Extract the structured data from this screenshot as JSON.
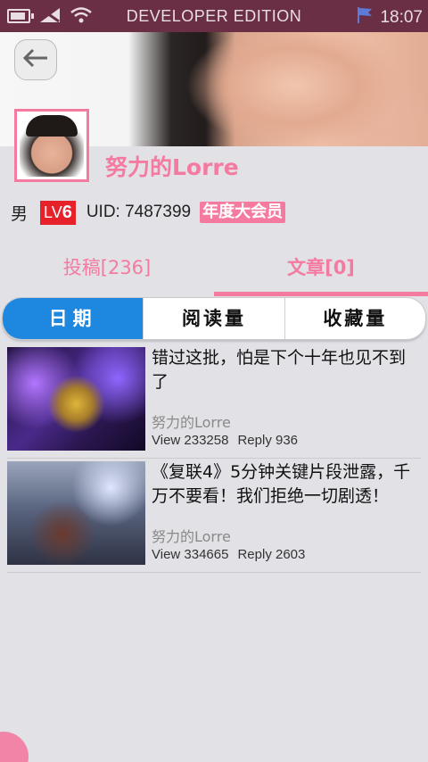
{
  "statusbar": {
    "center_text": "DEVELOPER EDITION",
    "time": "18:07",
    "icons": [
      "battery-icon",
      "no-sim-icon",
      "wifi-icon",
      "flag-icon"
    ]
  },
  "profile": {
    "username": "努力的Lorre",
    "gender": "男",
    "level_prefix": "LV",
    "level": "6",
    "uid": "UID: 7487399",
    "vip_badge": "年度大会员"
  },
  "tabs": [
    {
      "label": "投稿[236]",
      "selected": false
    },
    {
      "label": "文章[0]",
      "selected": true
    }
  ],
  "sort": [
    {
      "label": "日期",
      "selected": true
    },
    {
      "label": "阅读量",
      "selected": false
    },
    {
      "label": "收藏量",
      "selected": false
    }
  ],
  "articles": [
    {
      "title": "错过这批，怕是下个十年也见不到了",
      "author": "努力的Lorre",
      "views": "View 233258",
      "replies": "Reply 936"
    },
    {
      "title": "《复联4》5分钟关键片段泄露，千万不要看！我们拒绝一切剧透！",
      "author": "努力的Lorre",
      "views": "View 334665",
      "replies": "Reply 2603"
    }
  ],
  "colors": {
    "accent": "#f47aa0",
    "statusbar": "#6b2f45",
    "selected_segment": "#1e88e0",
    "level_badge": "#e6212a",
    "background": "#e1e1e6"
  }
}
